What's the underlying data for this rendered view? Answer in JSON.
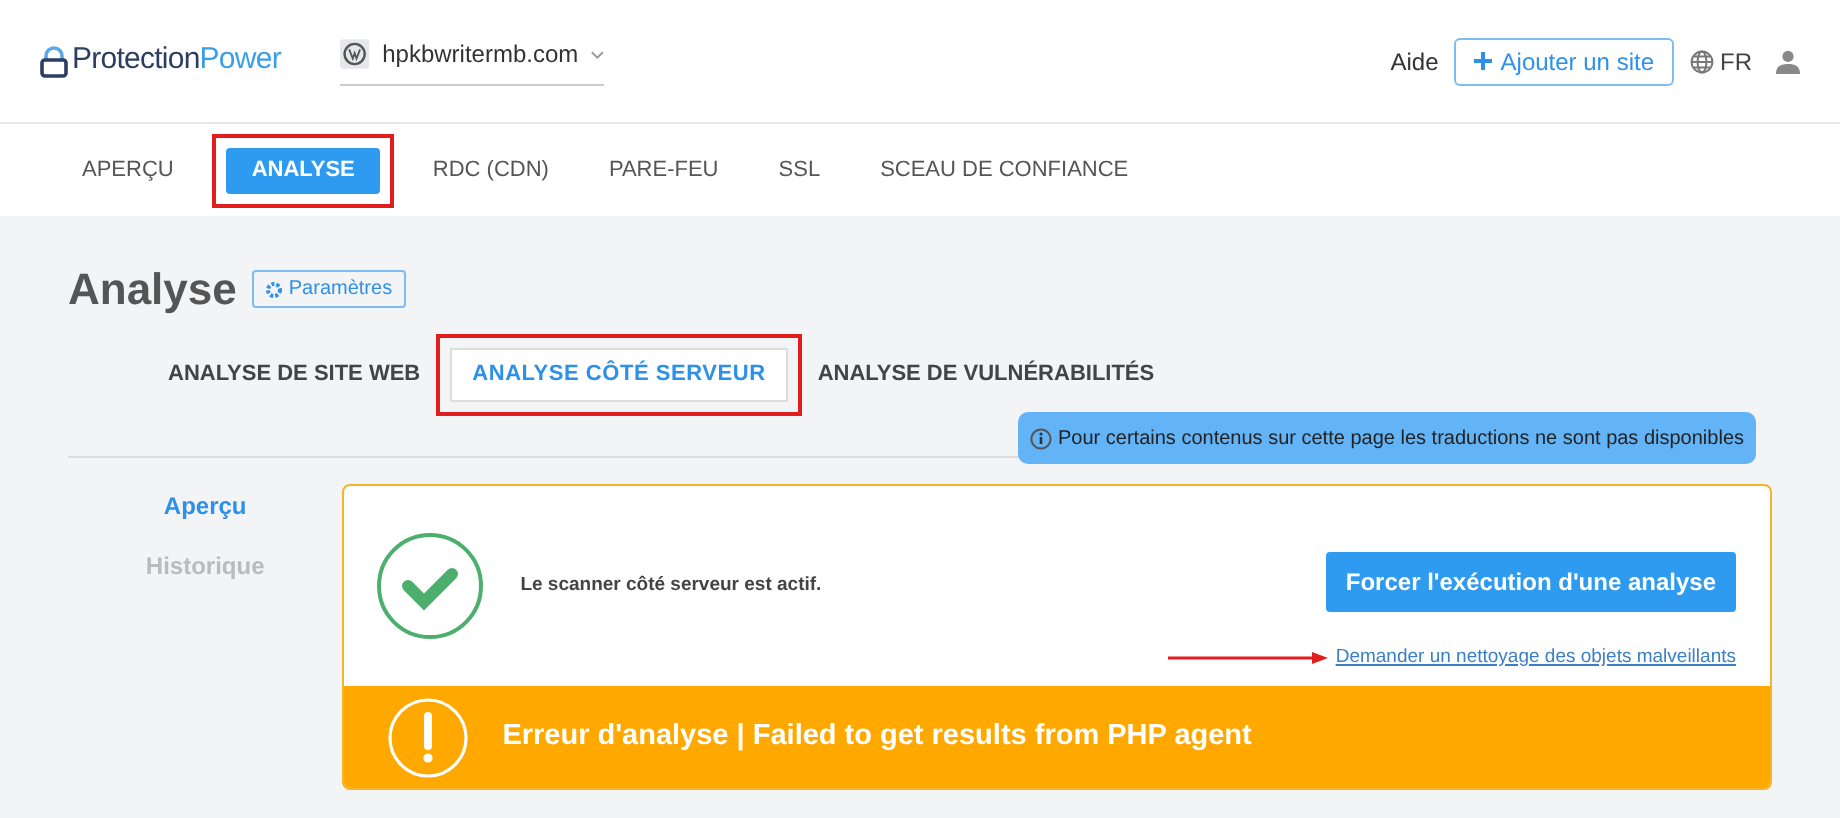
{
  "header": {
    "logo": {
      "first": "Protection",
      "second": "Power"
    },
    "site": "hpkbwritermb.com",
    "help": "Aide",
    "add_site": "Ajouter un site",
    "language": "FR"
  },
  "nav": [
    {
      "label": "APERÇU",
      "selected": false,
      "highlighted": false
    },
    {
      "label": "ANALYSE",
      "selected": true,
      "highlighted": true
    },
    {
      "label": "RDC (CDN)",
      "selected": false,
      "highlighted": false
    },
    {
      "label": "PARE-FEU",
      "selected": false,
      "highlighted": false
    },
    {
      "label": "SSL",
      "selected": false,
      "highlighted": false
    },
    {
      "label": "SCEAU DE CONFIANCE",
      "selected": false,
      "highlighted": false
    }
  ],
  "page": {
    "title": "Analyse",
    "settings": "Paramètres"
  },
  "subtabs": [
    {
      "label": "ANALYSE DE SITE WEB",
      "selected": false,
      "highlighted": false
    },
    {
      "label": "ANALYSE CÔTÉ SERVEUR",
      "selected": true,
      "highlighted": true
    },
    {
      "label": "ANALYSE DE VULNÉRABILITÉS",
      "selected": false,
      "highlighted": false
    }
  ],
  "notice": "Pour certains contenus sur cette page les traductions ne sont pas disponibles",
  "sidebar": [
    {
      "label": "Aperçu",
      "selected": true
    },
    {
      "label": "Historique",
      "selected": false
    }
  ],
  "card": {
    "status": "Le scanner côté serveur est actif.",
    "force_button": "Forcer l'exécution d'une analyse",
    "cleanup_link": "Demander un nettoyage des objets malveillants",
    "error": "Erreur d'analyse | Failed to get results from PHP agent"
  }
}
